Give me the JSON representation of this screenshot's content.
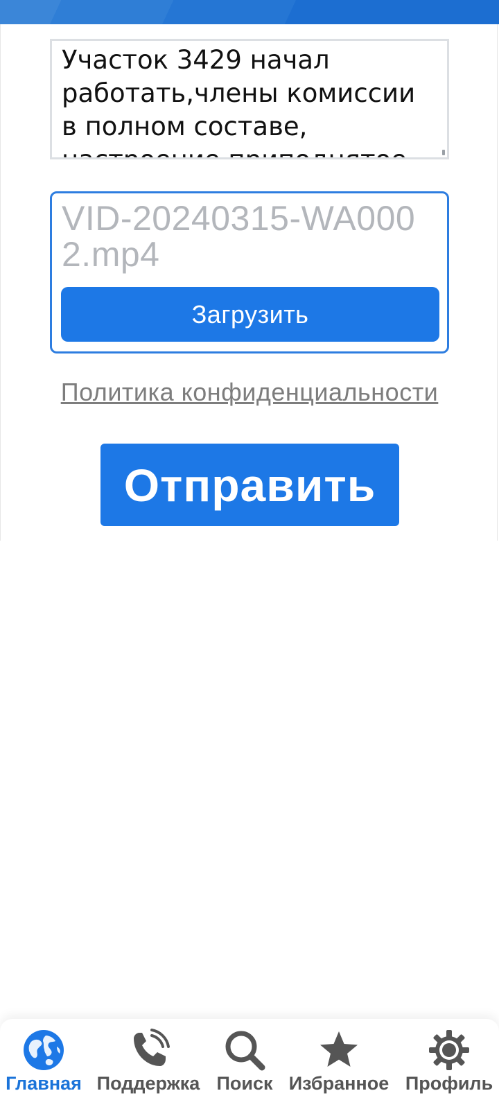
{
  "form": {
    "message_text": "Участок 3429 начал работать,члены комиссии в полном составе, настроение приподнятое",
    "attached_file": "VID-20240315-WA0002.mp4",
    "upload_label": "Загрузить",
    "privacy_label": "Политика конфиденциальности",
    "send_label": "Отправить"
  },
  "nav": {
    "items": [
      {
        "label": "Главная",
        "icon": "globe-icon",
        "active": true
      },
      {
        "label": "Поддержка",
        "icon": "phone-icon",
        "active": false
      },
      {
        "label": "Поиск",
        "icon": "search-icon",
        "active": false
      },
      {
        "label": "Избранное",
        "icon": "star-icon",
        "active": false
      },
      {
        "label": "Профиль",
        "icon": "gear-icon",
        "active": false
      }
    ]
  },
  "colors": {
    "accent": "#1d78e6",
    "header": "#2576d4",
    "inactive": "#555555",
    "placeholder": "#b3b6bb"
  }
}
